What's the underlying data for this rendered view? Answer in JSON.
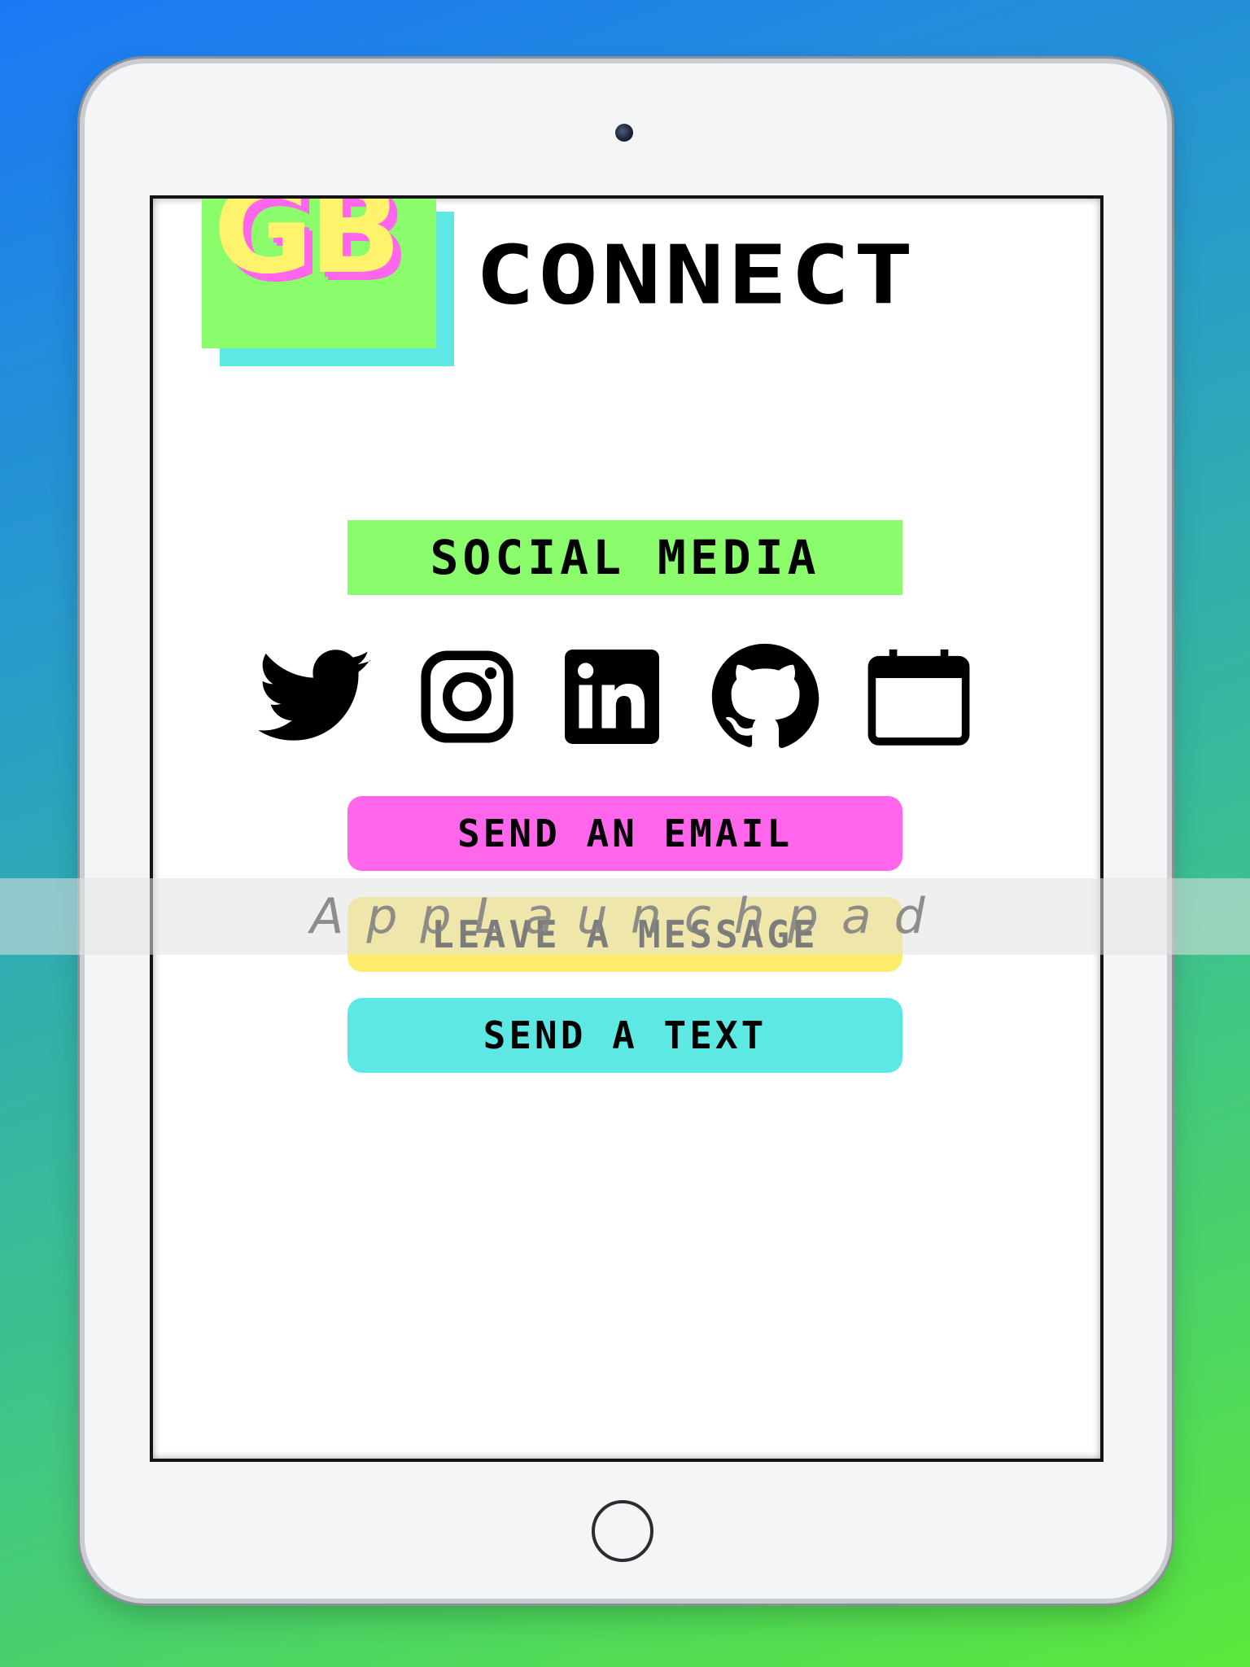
{
  "app": {
    "logo_text": "GB",
    "brand_title": "CONNECT"
  },
  "section": {
    "title": "SOCIAL MEDIA"
  },
  "social_icons": [
    "twitter-icon",
    "instagram-icon",
    "linkedin-icon",
    "github-icon",
    "calendar-icon"
  ],
  "actions": {
    "email_label": "SEND AN EMAIL",
    "message_label": "LEAVE A MESSAGE",
    "text_label": "SEND A TEXT"
  },
  "watermark": {
    "text": "AppLaunchpad"
  },
  "colors": {
    "green": "#8bfc6c",
    "pink": "#ff66ec",
    "yellow": "#ffec6b",
    "cyan": "#5ee8e4"
  }
}
